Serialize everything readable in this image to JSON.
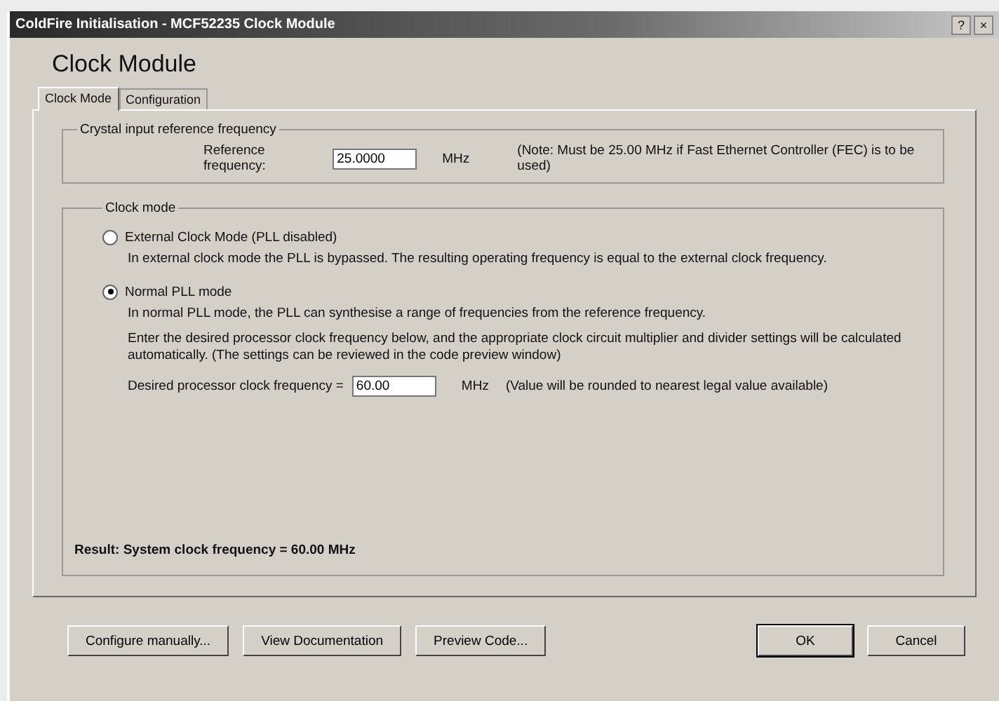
{
  "window": {
    "title": "ColdFire Initialisation - MCF52235 Clock Module",
    "help": "?",
    "close": "×"
  },
  "heading": "Clock Module",
  "tabs": [
    {
      "label": "Clock Mode",
      "selected": true
    },
    {
      "label": "Configuration",
      "selected": false
    }
  ],
  "crystal_group": {
    "title": "Crystal input reference frequency",
    "label": "Reference frequency:",
    "value": "25.0000",
    "unit": "MHz",
    "note": "(Note: Must be 25.00 MHz if Fast Ethernet Controller (FEC) is to be used)"
  },
  "clock_group": {
    "title": "Clock mode",
    "options": [
      {
        "label": "External Clock Mode (PLL disabled)",
        "selected": false,
        "descriptions": [
          "In external clock mode the PLL is bypassed. The resulting operating frequency is equal to the external clock frequency."
        ]
      },
      {
        "label": "Normal PLL mode",
        "selected": true,
        "descriptions": [
          "In normal PLL mode, the PLL can synthesise a range of frequencies from the reference frequency.",
          "Enter the desired processor clock frequency below, and the appropriate clock circuit multiplier and divider settings will be calculated automatically. (The settings can be reviewed in the code preview window)"
        ]
      }
    ],
    "desired_label": "Desired processor clock frequency =",
    "desired_value": "60.00",
    "desired_unit": "MHz",
    "desired_note": "(Value will be rounded to nearest legal value available)",
    "result": "Result: System clock frequency = 60.00 MHz"
  },
  "buttons": [
    {
      "label": "Configure manually...",
      "kind": "normal"
    },
    {
      "label": "View Documentation",
      "kind": "normal"
    },
    {
      "label": "Preview Code...",
      "kind": "normal"
    },
    {
      "label": "OK",
      "kind": "default"
    },
    {
      "label": "Cancel",
      "kind": "normal"
    }
  ]
}
